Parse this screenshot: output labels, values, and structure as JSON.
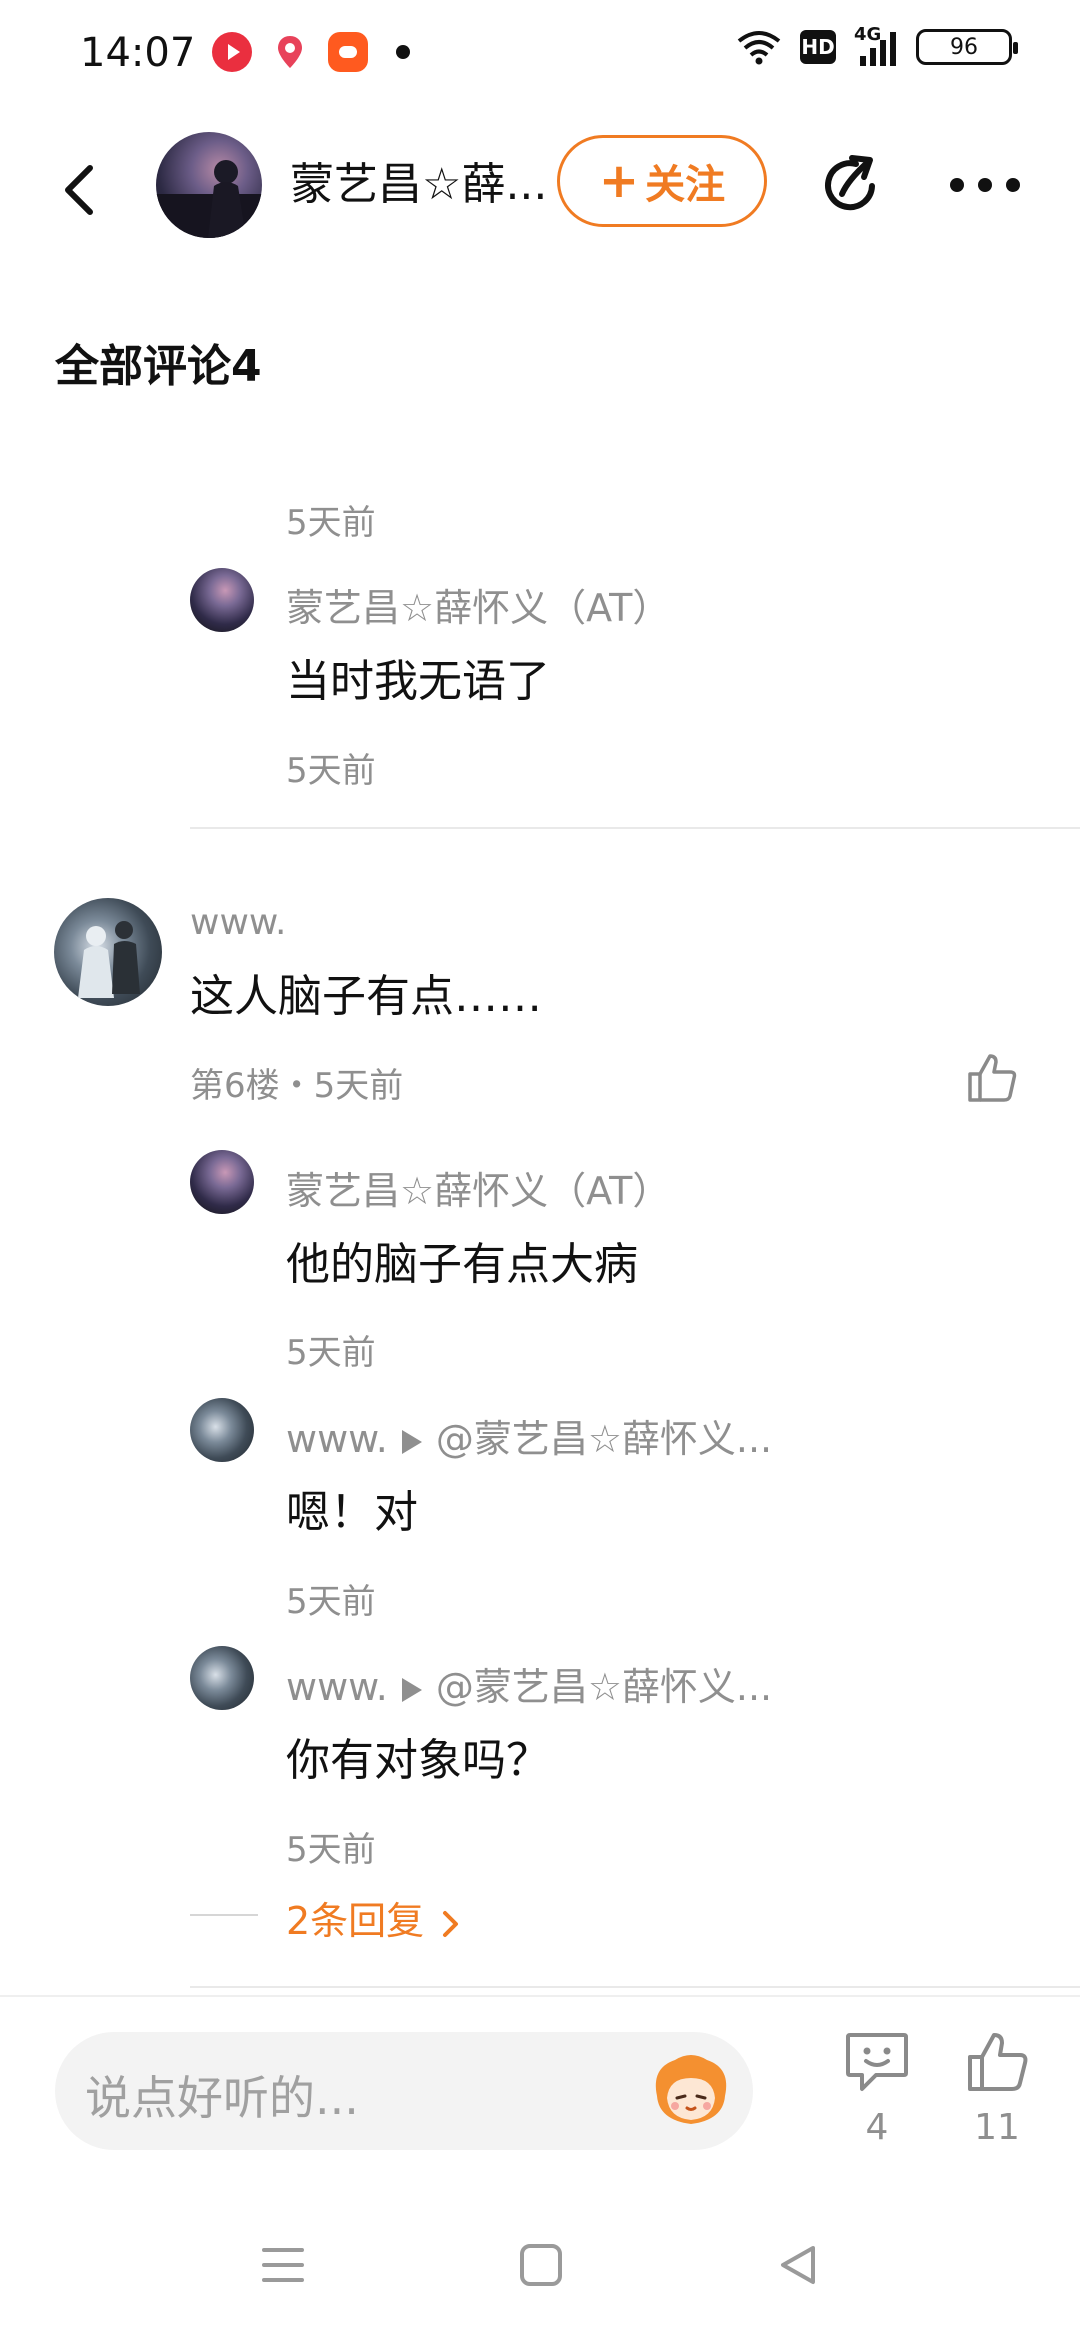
{
  "status_bar": {
    "time": "14:07",
    "hd_label": "HD",
    "network_label": "4G",
    "battery": "96"
  },
  "header": {
    "user_name": "蒙艺昌☆薛...",
    "follow_label": "关注",
    "follow_plus": "+"
  },
  "comments": {
    "title": "全部评论4",
    "top_partial": {
      "time": "5天前",
      "reply": {
        "author": "蒙艺昌☆薛怀义（AT）",
        "text": "当时我无语了",
        "time": "5天前"
      }
    },
    "main": {
      "author": "www.",
      "text": "这人脑子有点……",
      "meta": "第6楼・5天前",
      "replies": [
        {
          "author": "蒙艺昌☆薛怀义（AT）",
          "target": "",
          "text": "他的脑子有点大病",
          "time": "5天前"
        },
        {
          "author": "www.",
          "target": "@蒙艺昌☆薛怀义...",
          "text": "嗯！对",
          "time": "5天前"
        },
        {
          "author": "www.",
          "target": "@蒙艺昌☆薛怀义...",
          "text": "你有对象吗？",
          "time": "5天前"
        }
      ],
      "more_replies": "2条回复"
    }
  },
  "input_bar": {
    "placeholder": "说点好听的...",
    "comment_count": "4",
    "like_count": "11"
  },
  "colors": {
    "accent": "#f07b22",
    "muted": "#8f8f8f",
    "text": "#111111"
  },
  "icons": [
    "back-icon",
    "share-icon",
    "more-icon",
    "like-icon",
    "comment-icon",
    "emoji-icon",
    "menu-icon",
    "home-icon",
    "back-nav-icon",
    "wifi-icon",
    "signal-icon"
  ]
}
